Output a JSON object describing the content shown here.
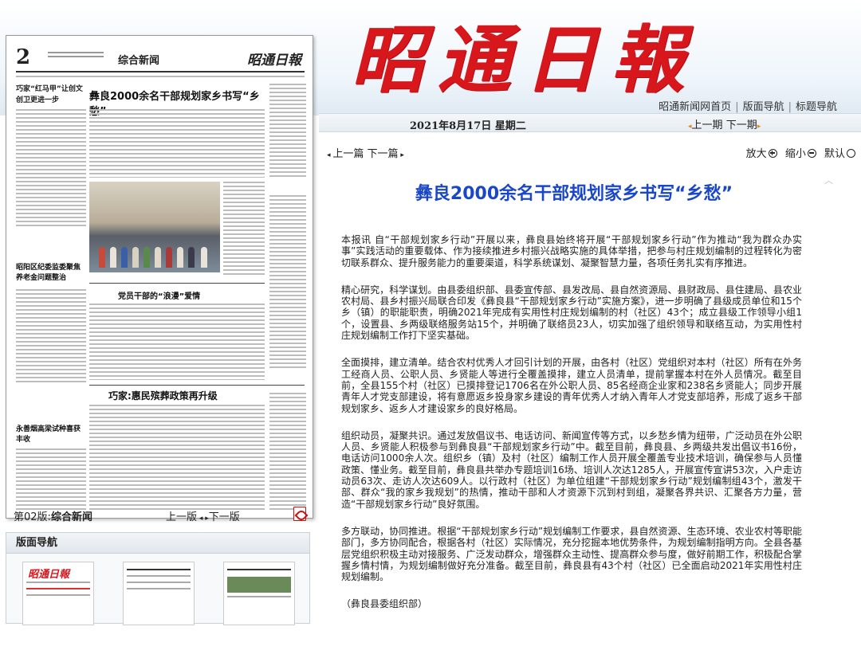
{
  "masthead": {
    "chars": [
      "昭",
      "通",
      "日",
      "報"
    ]
  },
  "top_links": [
    "昭通新闻网首页",
    "版面导航",
    "标题导航"
  ],
  "date_bar": {
    "date": "2021年8月17日 星期二",
    "prev_issue": "上一期",
    "next_issue": "下一期"
  },
  "article_toolbar": {
    "prev_article": "上一篇",
    "next_article": "下一篇",
    "zoom_in": "放大",
    "zoom_out": "缩小",
    "default": "默认"
  },
  "thumbnail": {
    "page_num": "2",
    "section": "综合新闻",
    "logo": "昭通日報",
    "lede_title": "巧家“红马甲”让创文创卫更进一步",
    "main_title": "彝良2000余名干部规划家乡书写“乡愁”",
    "box1_title": "党员干部的“浪漫”爱情",
    "box2_title": "巧家:惠民殡葬政策再升级",
    "side1_title": "昭阳区纪委监委聚焦养老金问题整治",
    "side2_title": "永善烟高梁试种喜获丰收"
  },
  "page_info": {
    "label_prefix": "第02版:",
    "label_name": "综合新闻",
    "prev_page": "上一版",
    "next_page": "下一版"
  },
  "layout_nav": {
    "title": "版面导航"
  },
  "article": {
    "title": "彝良2000余名干部规划家乡书写“乡愁”",
    "paragraphs": [
      "本报讯 自“干部规划家乡行动”开展以来，彝良县始终将开展“干部规划家乡行动”作为推动“我为群众办实事”实践活动的重要载体、作为接续推进乡村振兴战略实施的具体举措，把参与村庄规划编制的过程转化为密切联系群众、提升服务能力的重要渠道，科学系统谋划、凝聚智慧力量，各项任务扎实有序推进。",
      "精心研究，科学谋划。由县委组织部、县委宣传部、县发改局、县自然资源局、县财政局、县住建局、县农业农村局、县乡村振兴局联合印发《彝良县“干部规划家乡行动”实施方案》，进一步明确了县级成员单位和15个乡（镇）的职能职责，明确2021年完成有实用性村庄规划编制的村（社区）43个；成立县级工作领导小组1个，设置县、乡两级联络服务站15个，并明确了联络员23人，切实加强了组织领导和联络互动，为实用性村庄规划编制工作打下坚实基础。",
      "全面摸排，建立清单。结合农村优秀人才回引计划的开展，由各村（社区）党组织对本村（社区）所有在外务工经商人员、公职人员、乡贤能人等进行全覆盖摸排，建立人员清单，提前掌握本村在外人员情况。截至目前，全县155个村（社区）已摸排登记1706名在外公职人员、85名经商企业家和238名乡贤能人；同步开展青年人才党支部建设，将有意愿返乡投身家乡建设的青年优秀人才纳入青年人才党支部培养，形成了返乡干部规划家乡、返乡人才建设家乡的良好格局。",
      "组织动员，凝聚共识。通过发放倡议书、电话访问、新闻宣传等方式，以乡愁乡情为纽带，广泛动员在外公职人员、乡贤能人积极参与到彝良县“干部规划家乡行动”中。截至目前，彝良县、乡两级共发出倡议书16份，电话访问1000余人次。组织乡（镇）及村（社区）编制工作人员开展全覆盖专业技术培训，确保参与人员懂政策、懂业务。截至目前，彝良县共举办专题培训16场、培训人次达1285人，开展宣传宣讲53次，入户走访动员63次、走访人次达609人。以行政村（社区）为单位组建“干部规划家乡行动”规划编制组43个，激发干部、群众“我的家乡我规划”的热情，推动干部和人才资源下沉到村到组，凝聚各界共识、汇聚各方力量，营造“干部规划家乡行动”良好氛围。",
      "多方联动，协同推进。根据“干部规划家乡行动”规划编制工作要求，县自然资源、生态环境、农业农村等职能部门，多方协同配合，根据各村（社区）实际情况，充分挖掘本地优势条件，为规划编制指明方向。全县各基层党组织积极主动对接服务、广泛发动群众，增强群众主动性、提高群众参与度，做好前期工作，积极配合掌握乡情村情，为规划编制做好充分准备。截至目前，彝良县有43个村（社区）已全面启动2021年实用性村庄规划编制。",
      "（彝良县委组织部）"
    ]
  },
  "colors": {
    "masthead_red": "#d8171c",
    "headline_blue": "#1a47c8",
    "arrow_orange": "#e08a1e"
  }
}
